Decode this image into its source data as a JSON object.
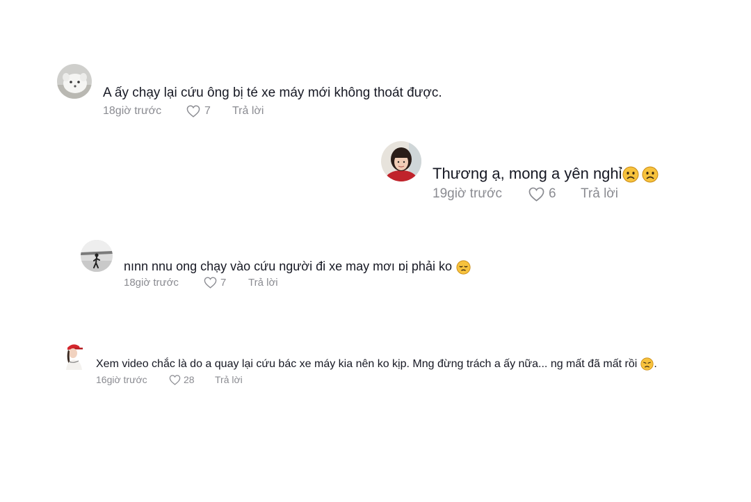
{
  "comments": [
    {
      "text": "A ấy chạy lại cứu ông bị té xe máy mới không thoát được.",
      "time": "18giờ trước",
      "likes": "7",
      "reply_label": "Trả lời",
      "avatar_icon": "white-dog-avatar"
    },
    {
      "text": "Thương ạ, mong a yên nghỉ",
      "emojis": [
        "sad-face-emoji",
        "sad-face-emoji"
      ],
      "time": "19giờ trước",
      "likes": "6",
      "reply_label": "Trả lời",
      "avatar_icon": "woman-portrait-avatar"
    },
    {
      "text": "nınn nnu ong chạy vào cứu người đi xe may mơı ɒị phải ko",
      "emojis": [
        "pensive-face-emoji"
      ],
      "time": "18giờ trước",
      "likes": "7",
      "reply_label": "Trả lời",
      "avatar_icon": "silhouette-figure-avatar"
    },
    {
      "text": "Xem video chắc là do a quay lại cứu bác xe máy kia nên ko kịp. Mng đừng trách a ấy nữa... ng mất đã mất rồi",
      "text_suffix": ".",
      "emojis": [
        "disappointed-face-emoji"
      ],
      "time": "16giờ trước",
      "likes": "28",
      "reply_label": "Trả lời",
      "avatar_icon": "girl-red-cap-avatar"
    }
  ],
  "colors": {
    "text": "#161823",
    "meta": "#8a8b91",
    "emoji_face": "#f7c23d",
    "emoji_outline": "#c98a12"
  }
}
